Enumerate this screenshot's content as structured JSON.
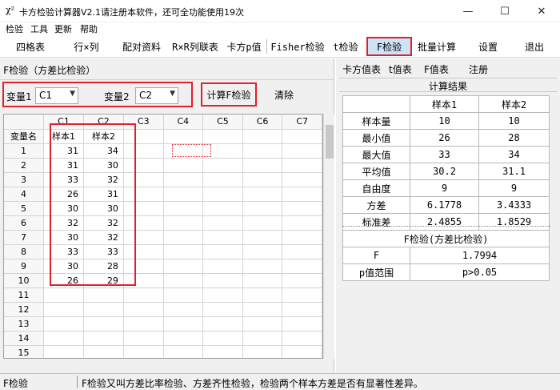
{
  "window": {
    "icon_glyph": "χ²",
    "title": "卡方检验计算器V2.1",
    "notice": "请注册本软件，还可全功能使用19次",
    "min_glyph": "—",
    "max_glyph": "☐",
    "close_glyph": "✕"
  },
  "menu": [
    "检验",
    "工具",
    "更新",
    "帮助"
  ],
  "toolbar": {
    "items": [
      "四格表",
      "行×列",
      "配对资料",
      "R×R列联表",
      "卡方p值",
      "Fisher检验",
      "t检验",
      "F检验",
      "批量计算",
      "设置",
      "退出"
    ],
    "active": "F检验"
  },
  "left": {
    "title": "F检验（方差比检验）",
    "var1_label": "变量1",
    "var1_value": "C1",
    "var2_label": "变量2",
    "var2_value": "C2",
    "compute_button": "计算F检验",
    "clear_button": "清除"
  },
  "sheet": {
    "columns": [
      "C1",
      "C2",
      "C3",
      "C4",
      "C5",
      "C6",
      "C7"
    ],
    "header_row_label": "变量名",
    "var_names": [
      "样本1",
      "样本2"
    ],
    "rows": [
      {
        "n": "1",
        "c1": "31",
        "c2": "34"
      },
      {
        "n": "2",
        "c1": "31",
        "c2": "30"
      },
      {
        "n": "3",
        "c1": "33",
        "c2": "32"
      },
      {
        "n": "4",
        "c1": "26",
        "c2": "31"
      },
      {
        "n": "5",
        "c1": "30",
        "c2": "30"
      },
      {
        "n": "6",
        "c1": "32",
        "c2": "32"
      },
      {
        "n": "7",
        "c1": "30",
        "c2": "32"
      },
      {
        "n": "8",
        "c1": "33",
        "c2": "33"
      },
      {
        "n": "9",
        "c1": "30",
        "c2": "28"
      },
      {
        "n": "10",
        "c1": "26",
        "c2": "29"
      },
      {
        "n": "11",
        "c1": "",
        "c2": ""
      },
      {
        "n": "12",
        "c1": "",
        "c2": ""
      },
      {
        "n": "13",
        "c1": "",
        "c2": ""
      },
      {
        "n": "14",
        "c1": "",
        "c2": ""
      },
      {
        "n": "15",
        "c1": "",
        "c2": ""
      }
    ]
  },
  "right": {
    "tabs": [
      "卡方值表",
      "t值表",
      "F值表",
      "注册"
    ],
    "result_title": "计算结果",
    "col_headers": [
      "样本1",
      "样本2"
    ],
    "stats": [
      {
        "label": "样本量",
        "v1": "10",
        "v2": "10"
      },
      {
        "label": "最小值",
        "v1": "26",
        "v2": "28"
      },
      {
        "label": "最大值",
        "v1": "33",
        "v2": "34"
      },
      {
        "label": "平均值",
        "v1": "30.2",
        "v2": "31.1"
      },
      {
        "label": "自由度",
        "v1": "9",
        "v2": "9"
      },
      {
        "label": "方差",
        "v1": "6.1778",
        "v2": "3.4333"
      },
      {
        "label": "标准差",
        "v1": "2.4855",
        "v2": "1.8529"
      }
    ],
    "ftest_title": "F检验(方差比检验)",
    "f_label": "F",
    "f_value": "1.7994",
    "p_label": "p值范围",
    "p_value": "p>0.05"
  },
  "status": {
    "left": "F检验",
    "right": "F检验又叫方差比率检验、方差齐性检验，检验两个样本方差是否有显著性差异。"
  }
}
